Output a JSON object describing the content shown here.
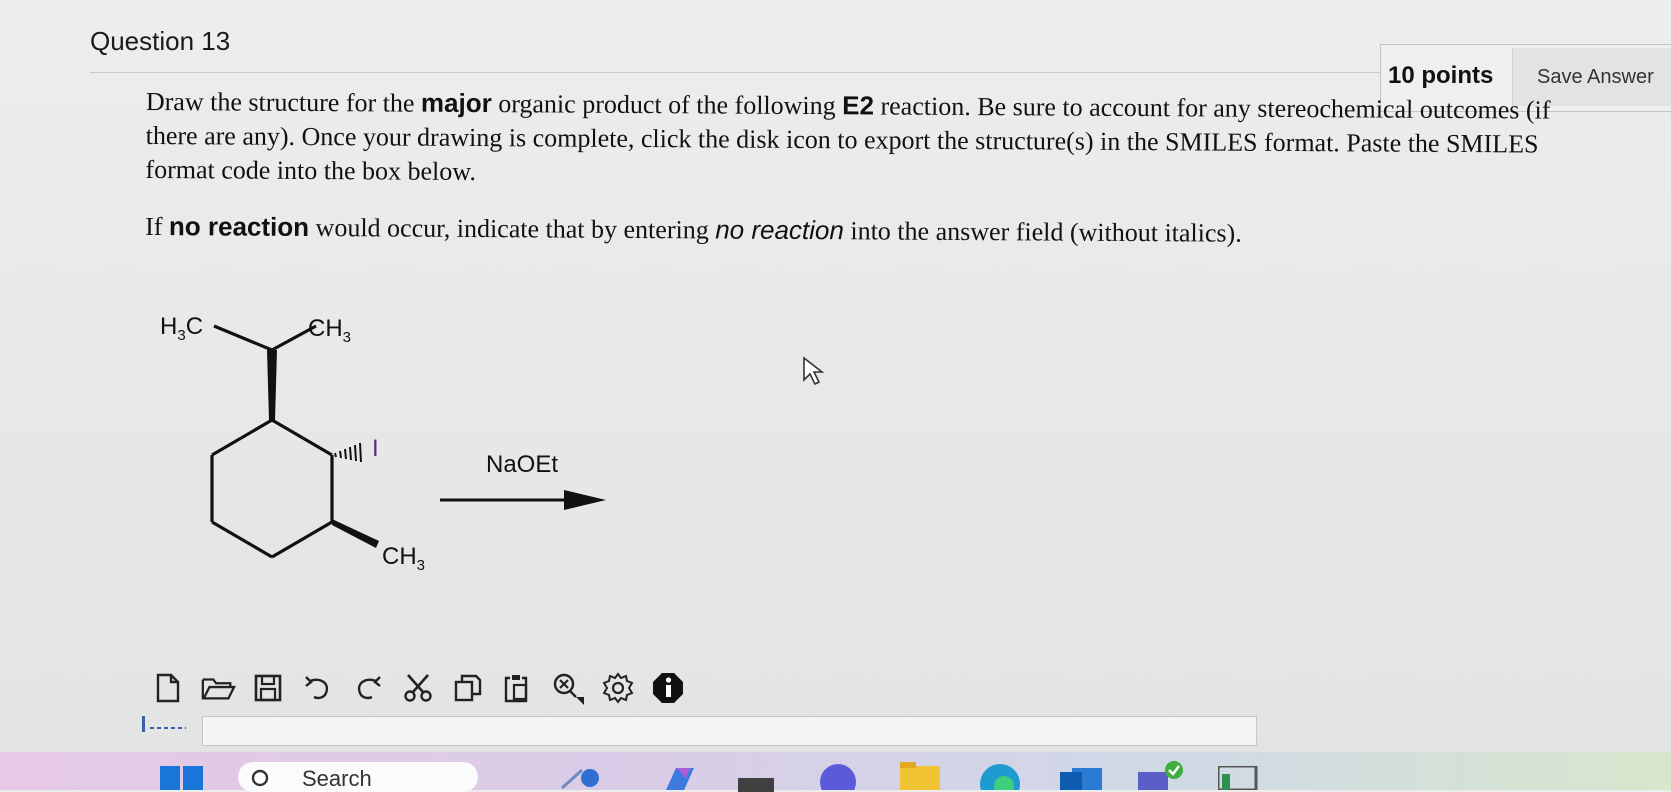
{
  "question": {
    "title": "Question 13",
    "points": "10 points",
    "save_label": "Save Answer"
  },
  "prompt": {
    "p1_a": "Draw the structure for the ",
    "p1_major": "major",
    "p1_b": " organic product of the following ",
    "p1_e2": "E2",
    "p1_c": " reaction. Be sure to account for any stereochemical outcomes (if there are any). Once your drawing is complete, click the disk icon to export the structure(s) in the SMILES format. Paste the SMILES format code into the box below.",
    "p2_a": "If ",
    "p2_bold": "no reaction",
    "p2_b": " would occur, indicate that by entering ",
    "p2_italic": "no reaction",
    "p2_c": " into the answer field (without italics)."
  },
  "molecule": {
    "label_h3c": "H3C",
    "label_ch3_top": "CH3",
    "label_i": "I",
    "label_ch3_bottom": "CH3",
    "reagent": "NaOEt",
    "iodine_color": "#5b2a86"
  },
  "toolbar": {
    "icons": [
      "new-file-icon",
      "open-folder-icon",
      "save-disk-icon",
      "undo-icon",
      "redo-icon",
      "cut-icon",
      "copy-icon",
      "paste-icon",
      "clear-icon",
      "settings-icon",
      "info-icon"
    ]
  },
  "taskbar": {
    "search_label": "Search"
  }
}
